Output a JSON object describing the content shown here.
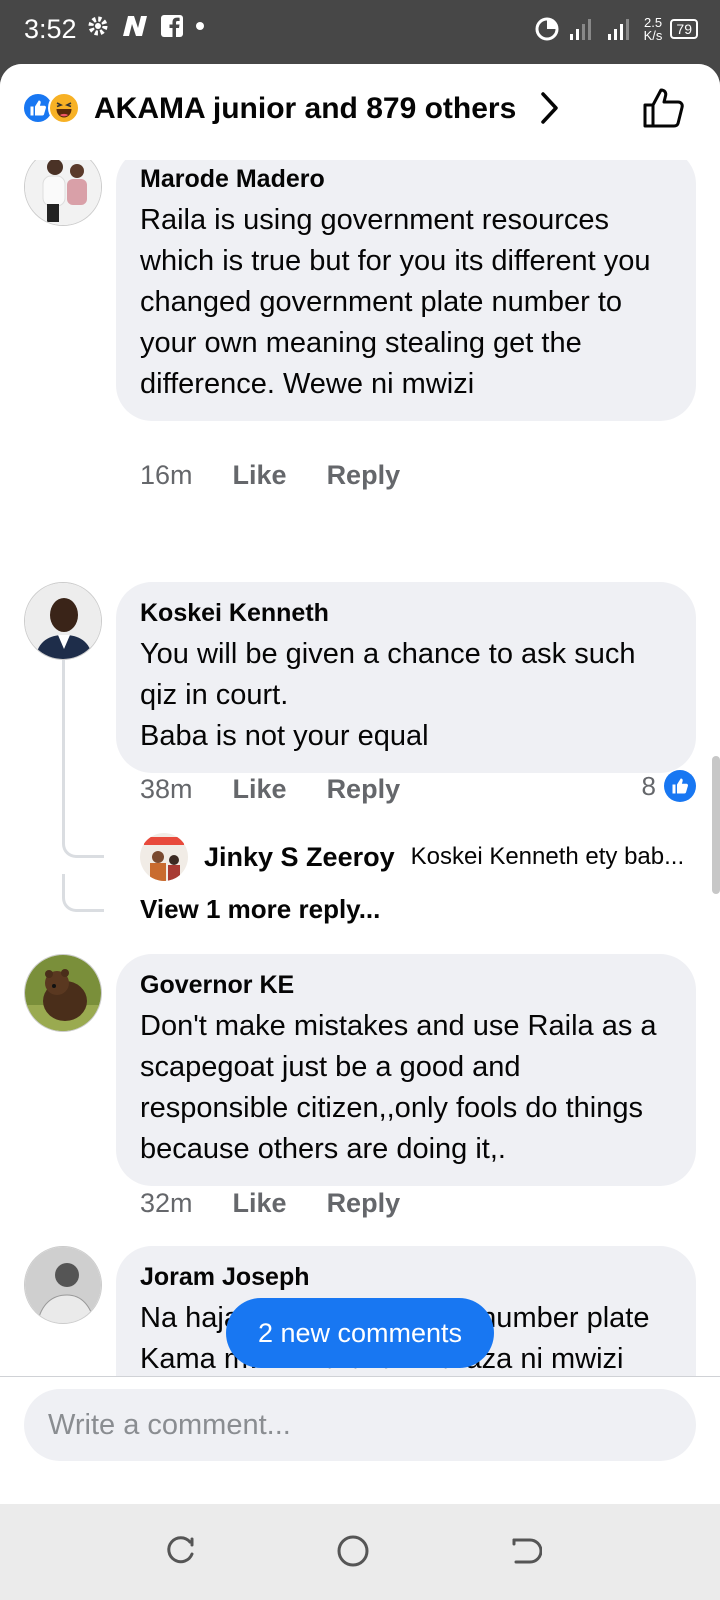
{
  "status_bar": {
    "time": "3:52",
    "net_speed_value": "2.5",
    "net_speed_unit": "K/s",
    "battery": "79",
    "network_type": "3G"
  },
  "header": {
    "reactions_text": "AKAMA junior and 879 others"
  },
  "comments": [
    {
      "name": "Marode Madero",
      "text": "Raila is using government resources which is true but for you its different you changed government plate number to your own meaning stealing get the difference. Wewe ni mwizi",
      "time": "16m",
      "like": "Like",
      "reply": "Reply"
    },
    {
      "name": "Koskei Kenneth",
      "text": "You will be given a chance to ask such qiz in court.\nBaba is not your equal",
      "time": "38m",
      "like": "Like",
      "reply": "Reply",
      "like_count": "8",
      "replies": [
        {
          "name": "Jinky S Zeeroy",
          "text": "Koskei Kenneth ety bab..."
        }
      ],
      "view_more": "View 1 more reply..."
    },
    {
      "name": "Governor KE",
      "text": "Don't make mistakes and use Raila as a scapegoat just be a good and responsible citizen,,only fools do things because others are doing it,.",
      "time": "32m",
      "like": "Like",
      "reply": "Reply"
    },
    {
      "name": "Joram Joseph",
      "text": "Na hajaiba na kubadilisha number plate Kama mwizi Baraza.. Baraza ni mwizi              shikwa ijumaa"
    }
  ],
  "new_comments_pill": "2 new comments",
  "composer": {
    "placeholder": "Write a comment..."
  },
  "colors": {
    "accent": "#1877f2",
    "bubble": "#eff0f4",
    "meta_text": "#65676b"
  }
}
